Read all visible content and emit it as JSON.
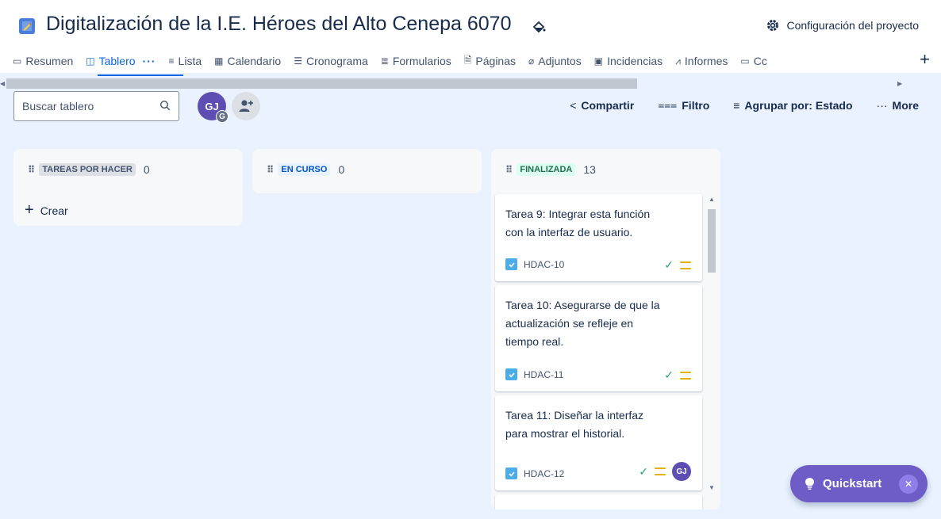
{
  "header": {
    "project_title": "Digitalización de la I.E. Héroes del Alto Cenepa 6070",
    "settings_label": "Configuración del proyecto"
  },
  "tabs": [
    {
      "label": "Resumen",
      "icon": "summary-icon"
    },
    {
      "label": "Tablero",
      "icon": "board-icon",
      "active": true
    },
    {
      "label": "Lista",
      "icon": "list-icon"
    },
    {
      "label": "Calendario",
      "icon": "calendar-icon"
    },
    {
      "label": "Cronograma",
      "icon": "timeline-icon"
    },
    {
      "label": "Formularios",
      "icon": "forms-icon"
    },
    {
      "label": "Páginas",
      "icon": "pages-icon"
    },
    {
      "label": "Adjuntos",
      "icon": "attachment-icon"
    },
    {
      "label": "Incidencias",
      "icon": "issues-icon"
    },
    {
      "label": "Informes",
      "icon": "reports-icon"
    },
    {
      "label": "Cc",
      "icon": "calendar-icon"
    }
  ],
  "toolbar": {
    "search_placeholder": "Buscar tablero",
    "avatar_initials": "GJ",
    "avatar_badge": "G",
    "share_label": "Compartir",
    "filter_label": "Filtro",
    "group_label": "Agrupar por: Estado",
    "more_label": "More"
  },
  "columns": [
    {
      "name": "TAREAS POR HACER",
      "count": "0",
      "create_label": "Crear",
      "color": "#dcdfe4",
      "text_color": "#44546f"
    },
    {
      "name": "EN CURSO",
      "count": "0",
      "color": "#e9f2ff",
      "text_color": "#0055cc"
    },
    {
      "name": "FINALIZADA",
      "count": "13",
      "color": "#dcfff1",
      "text_color": "#216e4e"
    }
  ],
  "cards": [
    {
      "title": "Tarea 9: Integrar esta función con la interfaz de usuario.",
      "key": "HDAC-10",
      "assignee": ""
    },
    {
      "title": "Tarea 10: Asegurarse de que la actualización se refleje en tiempo real.",
      "key": "HDAC-11",
      "assignee": ""
    },
    {
      "title": "Tarea 11: Diseñar la interfaz para mostrar el historial.",
      "key": "HDAC-12",
      "assignee": "GJ"
    }
  ],
  "quickstart": {
    "label": "Quickstart"
  }
}
